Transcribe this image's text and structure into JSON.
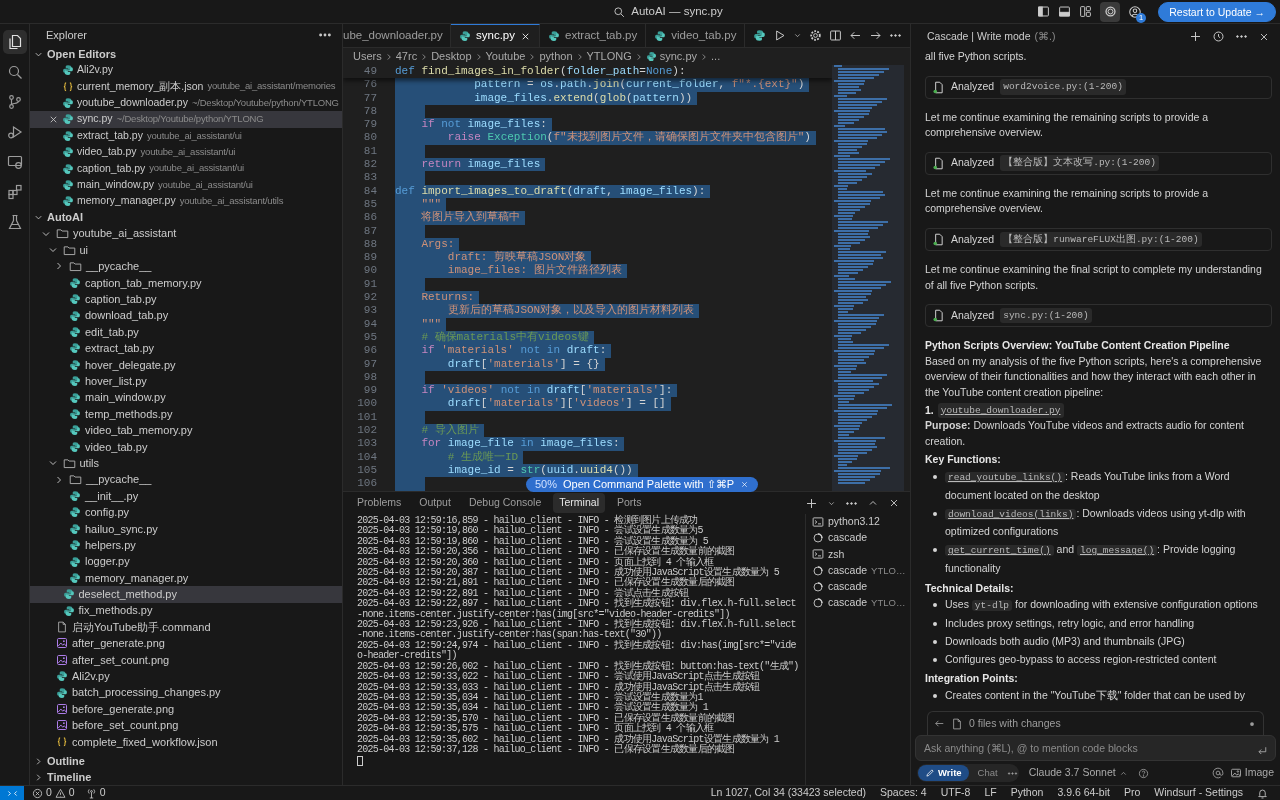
{
  "title_bar": {
    "title": "AutoAI — sync.py",
    "cascade_toggle_on": true,
    "account_badge": "1",
    "update_button": "Restart to Update →"
  },
  "activity_bar": [
    {
      "selected": true
    },
    {
      "selected": false
    },
    {
      "selected": false
    },
    {
      "selected": false
    },
    {
      "selected": false
    },
    {
      "selected": false
    },
    {
      "selected": false
    }
  ],
  "explorer": {
    "title": "Explorer",
    "open_editors": {
      "title": "Open Editors",
      "expanded": true,
      "items": [
        {
          "kind": "py",
          "name": "Ali2v.py",
          "selected": false
        },
        {
          "kind": "json",
          "name": "current_memory_副本.json",
          "path": "youtube_ai_assistant/memories",
          "selected": false
        },
        {
          "kind": "py",
          "name": "youtube_downloader.py",
          "path": "~/Desktop/Youtube/python/YTLONG",
          "selected": false
        },
        {
          "kind": "py",
          "name": "sync.py",
          "path": "~/Desktop/Youtube/python/YTLONG",
          "selected": true
        },
        {
          "kind": "py",
          "name": "extract_tab.py",
          "path": "youtube_ai_assistant/ui",
          "selected": false
        },
        {
          "kind": "py",
          "name": "video_tab.py",
          "path": "youtube_ai_assistant/ui",
          "selected": false
        },
        {
          "kind": "py",
          "name": "caption_tab.py",
          "path": "youtube_ai_assistant/ui",
          "selected": false
        },
        {
          "kind": "py",
          "name": "main_window.py",
          "path": "youtube_ai_assistant/ui",
          "selected": false
        },
        {
          "kind": "py",
          "name": "memory_manager.py",
          "path": "youtube_ai_assistant/utils",
          "selected": false
        }
      ]
    },
    "folder": {
      "title": "AutoAI",
      "expanded": true,
      "children": [
        {
          "kind": "folder",
          "name": "youtube_ai_assistant",
          "expanded": true,
          "selected": false,
          "children": [
            {
              "kind": "folder",
              "name": "ui",
              "expanded": true,
              "selected": false,
              "children": [
                {
                  "kind": "folder",
                  "name": "__pycache__",
                  "expanded": false,
                  "selected": false
                },
                {
                  "kind": "py",
                  "name": "caption_tab_memory.py",
                  "selected": false
                },
                {
                  "kind": "py",
                  "name": "caption_tab.py",
                  "selected": false
                },
                {
                  "kind": "py",
                  "name": "download_tab.py",
                  "selected": false
                },
                {
                  "kind": "py",
                  "name": "edit_tab.py",
                  "selected": false
                },
                {
                  "kind": "py",
                  "name": "extract_tab.py",
                  "selected": false
                },
                {
                  "kind": "py",
                  "name": "hover_delegate.py",
                  "selected": false
                },
                {
                  "kind": "py",
                  "name": "hover_list.py",
                  "selected": false
                },
                {
                  "kind": "py",
                  "name": "main_window.py",
                  "selected": false
                },
                {
                  "kind": "py",
                  "name": "temp_methods.py",
                  "selected": false
                },
                {
                  "kind": "py",
                  "name": "video_tab_memory.py",
                  "selected": false
                },
                {
                  "kind": "py",
                  "name": "video_tab.py",
                  "selected": false
                }
              ]
            },
            {
              "kind": "folder",
              "name": "utils",
              "expanded": true,
              "selected": false,
              "children": [
                {
                  "kind": "folder",
                  "name": "__pycache__",
                  "expanded": false,
                  "selected": false
                },
                {
                  "kind": "py",
                  "name": "__init__.py",
                  "selected": false
                },
                {
                  "kind": "py",
                  "name": "config.py",
                  "selected": false
                },
                {
                  "kind": "py",
                  "name": "hailuo_sync.py",
                  "selected": false
                },
                {
                  "kind": "py",
                  "name": "helpers.py",
                  "selected": false
                },
                {
                  "kind": "py",
                  "name": "logger.py",
                  "selected": false
                },
                {
                  "kind": "py",
                  "name": "memory_manager.py",
                  "selected": false
                }
              ]
            },
            {
              "kind": "py",
              "name": "deselect_method.py",
              "selected": true
            },
            {
              "kind": "py",
              "name": "fix_methods.py",
              "selected": false
            }
          ]
        },
        {
          "kind": "file",
          "name": "启动YouTube助手.command",
          "selected": false
        },
        {
          "kind": "png",
          "name": "after_generate.png",
          "selected": false
        },
        {
          "kind": "png",
          "name": "after_set_count.png",
          "selected": false
        },
        {
          "kind": "py",
          "name": "Ali2v.py",
          "selected": false
        },
        {
          "kind": "py",
          "name": "batch_processing_changes.py",
          "selected": false
        },
        {
          "kind": "png",
          "name": "before_generate.png",
          "selected": false
        },
        {
          "kind": "png",
          "name": "before_set_count.png",
          "selected": false
        },
        {
          "kind": "json",
          "name": "complete_fixed_workflow.json",
          "selected": false
        }
      ]
    },
    "outline": {
      "title": "Outline",
      "expanded": false
    },
    "timeline": {
      "title": "Timeline",
      "expanded": false
    }
  },
  "editor_tabs": [
    {
      "label": "ube_downloader.py",
      "icon": false,
      "selected": false
    },
    {
      "label": "sync.py",
      "icon": true,
      "selected": true
    },
    {
      "label": "extract_tab.py",
      "icon": true,
      "selected": false
    },
    {
      "label": "video_tab.py",
      "icon": true,
      "selected": false
    }
  ],
  "breadcrumbs": [
    {
      "kind": "folder",
      "label": "Users"
    },
    {
      "kind": "folder",
      "label": "47rc"
    },
    {
      "kind": "folder",
      "label": "Desktop"
    },
    {
      "kind": "folder",
      "label": "Youtube"
    },
    {
      "kind": "folder",
      "label": "python"
    },
    {
      "kind": "folder",
      "label": "YTLONG"
    },
    {
      "kind": "file",
      "label": "sync.py"
    },
    {
      "kind": "more",
      "label": "..."
    }
  ],
  "sticky_line": {
    "n": "49",
    "tokens": [
      {
        "kind": "keyword",
        "text": "def"
      },
      {
        "kind": "function",
        "text": " find_images_in_folder"
      },
      {
        "kind": "plain",
        "text": "("
      },
      {
        "kind": "variable",
        "text": "folder_path"
      },
      {
        "kind": "plain",
        "text": "="
      },
      {
        "kind": "keyword",
        "text": "None"
      },
      {
        "kind": "plain",
        "text": "):"
      }
    ]
  },
  "code": {
    "selected": true,
    "lines": [
      {
        "n": "76",
        "tokens": [
          {
            "kind": "variable",
            "text": "            pattern"
          },
          {
            "kind": "plain",
            "text": " = "
          },
          {
            "kind": "variable",
            "text": "os"
          },
          {
            "kind": "plain",
            "text": "."
          },
          {
            "kind": "variable",
            "text": "path"
          },
          {
            "kind": "plain",
            "text": "."
          },
          {
            "kind": "function",
            "text": "join"
          },
          {
            "kind": "plain",
            "text": "("
          },
          {
            "kind": "variable",
            "text": "current_folder"
          },
          {
            "kind": "plain",
            "text": ","
          },
          {
            "kind": "string",
            "text": " f\"*.{ext}\""
          },
          {
            "kind": "plain",
            "text": ")"
          }
        ]
      },
      {
        "n": "77",
        "tokens": [
          {
            "kind": "variable",
            "text": "            image_files"
          },
          {
            "kind": "plain",
            "text": "."
          },
          {
            "kind": "function",
            "text": "extend"
          },
          {
            "kind": "plain",
            "text": "("
          },
          {
            "kind": "function",
            "text": "glob"
          },
          {
            "kind": "plain",
            "text": "("
          },
          {
            "kind": "variable",
            "text": "pattern"
          },
          {
            "kind": "plain",
            "text": "))"
          }
        ]
      },
      {
        "n": "78"
      },
      {
        "n": "79",
        "tokens": [
          {
            "kind": "control",
            "text": "    if"
          },
          {
            "kind": "keyword",
            "text": " not"
          },
          {
            "kind": "variable",
            "text": " image_files"
          },
          {
            "kind": "plain",
            "text": ":"
          }
        ]
      },
      {
        "n": "80",
        "tokens": [
          {
            "kind": "control",
            "text": "        raise"
          },
          {
            "kind": "builtin",
            "text": " Exception"
          },
          {
            "kind": "plain",
            "text": "("
          },
          {
            "kind": "string",
            "text": "f\"未找到图片文件，请确保图片文件夹中包含图片\""
          },
          {
            "kind": "plain",
            "text": ")"
          }
        ]
      },
      {
        "n": "81"
      },
      {
        "n": "82",
        "tokens": [
          {
            "kind": "control",
            "text": "    return"
          },
          {
            "kind": "variable",
            "text": " image_files"
          }
        ]
      },
      {
        "n": "83"
      },
      {
        "n": "84",
        "tokens": [
          {
            "kind": "keyword",
            "text": "def"
          },
          {
            "kind": "function",
            "text": " import_images_to_draft"
          },
          {
            "kind": "plain",
            "text": "("
          },
          {
            "kind": "variable",
            "text": "draft"
          },
          {
            "kind": "plain",
            "text": ","
          },
          {
            "kind": "variable",
            "text": " image_files"
          },
          {
            "kind": "plain",
            "text": "):"
          }
        ]
      },
      {
        "n": "85",
        "tokens": [
          {
            "kind": "string",
            "text": "    \"\"\""
          }
        ]
      },
      {
        "n": "86",
        "tokens": [
          {
            "kind": "string",
            "text": "    将图片导入到草稿中"
          }
        ]
      },
      {
        "n": "87"
      },
      {
        "n": "88",
        "tokens": [
          {
            "kind": "string",
            "text": "    Args:"
          }
        ]
      },
      {
        "n": "89",
        "tokens": [
          {
            "kind": "string",
            "text": "        draft: 剪映草稿JSON对象"
          }
        ]
      },
      {
        "n": "90",
        "tokens": [
          {
            "kind": "string",
            "text": "        image_files: 图片文件路径列表"
          }
        ]
      },
      {
        "n": "91"
      },
      {
        "n": "92",
        "tokens": [
          {
            "kind": "string",
            "text": "    Returns:"
          }
        ]
      },
      {
        "n": "93",
        "tokens": [
          {
            "kind": "string",
            "text": "        更新后的草稿JSON对象，以及导入的图片材料列表"
          }
        ]
      },
      {
        "n": "94",
        "tokens": [
          {
            "kind": "string",
            "text": "    \"\"\""
          }
        ]
      },
      {
        "n": "95",
        "tokens": [
          {
            "kind": "comment",
            "text": "    # 确保materials中有videos键"
          }
        ]
      },
      {
        "n": "96",
        "tokens": [
          {
            "kind": "control",
            "text": "    if"
          },
          {
            "kind": "string",
            "text": " 'materials'"
          },
          {
            "kind": "keyword",
            "text": " not in"
          },
          {
            "kind": "variable",
            "text": " draft"
          },
          {
            "kind": "plain",
            "text": ":"
          }
        ]
      },
      {
        "n": "97",
        "tokens": [
          {
            "kind": "variable",
            "text": "        draft"
          },
          {
            "kind": "plain",
            "text": "["
          },
          {
            "kind": "string",
            "text": "'materials'"
          },
          {
            "kind": "plain",
            "text": "] = {}"
          }
        ]
      },
      {
        "n": "98"
      },
      {
        "n": "99",
        "tokens": [
          {
            "kind": "control",
            "text": "    if"
          },
          {
            "kind": "string",
            "text": " 'videos'"
          },
          {
            "kind": "keyword",
            "text": " not in"
          },
          {
            "kind": "variable",
            "text": " draft"
          },
          {
            "kind": "plain",
            "text": "["
          },
          {
            "kind": "string",
            "text": "'materials'"
          },
          {
            "kind": "plain",
            "text": "]:"
          }
        ]
      },
      {
        "n": "100",
        "tokens": [
          {
            "kind": "variable",
            "text": "        draft"
          },
          {
            "kind": "plain",
            "text": "["
          },
          {
            "kind": "string",
            "text": "'materials'"
          },
          {
            "kind": "plain",
            "text": "]["
          },
          {
            "kind": "string",
            "text": "'videos'"
          },
          {
            "kind": "plain",
            "text": "] = []"
          }
        ]
      },
      {
        "n": "101"
      },
      {
        "n": "102",
        "tokens": [
          {
            "kind": "comment",
            "text": "    # 导入图片"
          }
        ]
      },
      {
        "n": "103",
        "tokens": [
          {
            "kind": "control",
            "text": "    for"
          },
          {
            "kind": "variable",
            "text": " image_file"
          },
          {
            "kind": "keyword",
            "text": " in"
          },
          {
            "kind": "variable",
            "text": " image_files"
          },
          {
            "kind": "plain",
            "text": ":"
          }
        ]
      },
      {
        "n": "104",
        "tokens": [
          {
            "kind": "comment",
            "text": "        # 生成唯一ID"
          }
        ]
      },
      {
        "n": "105",
        "tokens": [
          {
            "kind": "variable",
            "text": "        image_id"
          },
          {
            "kind": "plain",
            "text": " = "
          },
          {
            "kind": "builtin",
            "text": "str"
          },
          {
            "kind": "plain",
            "text": "("
          },
          {
            "kind": "variable",
            "text": "uuid"
          },
          {
            "kind": "plain",
            "text": "."
          },
          {
            "kind": "function",
            "text": "uuid4"
          },
          {
            "kind": "plain",
            "text": "())"
          }
        ]
      },
      {
        "n": "106"
      }
    ]
  },
  "toast": {
    "percent": "50%",
    "text": "Open Command Palette with ⇧⌘P"
  },
  "panel_tabs": [
    {
      "label": "Problems",
      "selected": false
    },
    {
      "label": "Output",
      "selected": false
    },
    {
      "label": "Debug Console",
      "selected": false
    },
    {
      "label": "Terminal",
      "selected": true
    },
    {
      "label": "Ports",
      "selected": false
    }
  ],
  "terminal_lines": [
    "2025-04-03 12:59:16,859 - hailuo_client - INFO - 检测到图片上传成功",
    "2025-04-03 12:59:19,860 - hailuo_client - INFO - 尝试设置生成数量为5",
    "2025-04-03 12:59:19,860 - hailuo_client - INFO - 尝试设置生成数量为 5",
    "2025-04-03 12:59:20,356 - hailuo_client - INFO - 已保存设置生成数量前的截图",
    "2025-04-03 12:59:20,360 - hailuo_client - INFO - 页面上找到 4 个输入框",
    "2025-04-03 12:59:20,387 - hailuo_client - INFO - 成功使用JavaScript设置生成数量为 5",
    "2025-04-03 12:59:21,891 - hailuo_client - INFO - 已保存设置生成数量后的截图",
    "2025-04-03 12:59:22,891 - hailuo_client - INFO - 尝试点击生成按钮",
    "2025-04-03 12:59:22,897 - hailuo_client - INFO - 找到生成按钮: div.flex.h-full.select-none.items-center.justify-center:has(img[src*=\"video-header-credits\"])",
    "2025-04-03 12:59:23,926 - hailuo_client - INFO - 找到生成按钮: div.flex.h-full.select-none.items-center.justify-center:has(span:has-text(\"30\"))",
    "2025-04-03 12:59:24,974 - hailuo_client - INFO - 找到生成按钮: div:has(img[src*=\"video-header-credits\"])",
    "2025-04-03 12:59:26,002 - hailuo_client - INFO - 找到生成按钮: button:has-text(\"生成\")",
    "2025-04-03 12:59:33,022 - hailuo_client - INFO - 尝试使用JavaScript点击生成按钮",
    "2025-04-03 12:59:33,033 - hailuo_client - INFO - 成功使用JavaScript点击生成按钮",
    "2025-04-03 12:59:35,034 - hailuo_client - INFO - 尝试设置生成数量为1",
    "2025-04-03 12:59:35,034 - hailuo_client - INFO - 尝试设置生成数量为 1",
    "2025-04-03 12:59:35,570 - hailuo_client - INFO - 已保存设置生成数量前的截图",
    "2025-04-03 12:59:35,575 - hailuo_client - INFO - 页面上找到 4 个输入框",
    "2025-04-03 12:59:35,602 - hailuo_client - INFO - 成功使用JavaScript设置生成数量为 1",
    "2025-04-03 12:59:37,128 - hailuo_client - INFO - 已保存设置生成数量后的截图"
  ],
  "terminal_sessions": [
    {
      "kind": "shell",
      "name": "python3.12"
    },
    {
      "kind": "cascade",
      "name": "cascade"
    },
    {
      "kind": "shell",
      "name": "zsh"
    },
    {
      "kind": "cascade",
      "name": "cascade",
      "detail": "YTLO…"
    },
    {
      "kind": "cascade",
      "name": "cascade"
    },
    {
      "kind": "cascade",
      "name": "cascade",
      "detail": "YTLO…"
    }
  ],
  "cascade": {
    "title": "Cascade | Write mode",
    "shortcut": "(⌘.)",
    "messages": [
      {
        "kind": "text",
        "text": "all five Python scripts."
      },
      {
        "kind": "tool",
        "label": "Analyzed",
        "file": "word2voice.py:(1-200)"
      },
      {
        "kind": "text",
        "text": "Let me continue examining the remaining scripts to provide a comprehensive overview."
      },
      {
        "kind": "tool",
        "label": "Analyzed",
        "file": "【整合版】文本改写.py:(1-200)"
      },
      {
        "kind": "text",
        "text": "Let me continue examining the remaining scripts to provide a comprehensive overview."
      },
      {
        "kind": "tool",
        "label": "Analyzed",
        "file": "【整合版】runwareFLUX出图.py:(1-200)"
      },
      {
        "kind": "text",
        "text": "Let me continue examining the final script to complete my understanding of all five Python scripts."
      },
      {
        "kind": "tool",
        "label": "Analyzed",
        "file": "sync.py:(1-200)"
      },
      {
        "kind": "heading",
        "text": "Python Scripts Overview: YouTube Content Creation Pipeline"
      },
      {
        "kind": "text",
        "text": "Based on my analysis of the five Python scripts, here's a comprehensive overview of their functionalities and how they interact with each other in the YouTube content creation pipeline:"
      },
      {
        "kind": "numbered",
        "number": "1.",
        "code": "youtube_downloader.py"
      },
      {
        "kind": "rich",
        "text": "**Purpose:** Downloads YouTube videos and extracts audio for content creation."
      },
      {
        "kind": "heading",
        "text": "Key Functions:"
      },
      {
        "kind": "bullet",
        "parts": [
          {
            "kind": "link",
            "text": "read_youtube_links()"
          },
          {
            "kind": "text",
            "text": ": Reads YouTube links from a Word document located on the desktop"
          }
        ]
      },
      {
        "kind": "bullet",
        "parts": [
          {
            "kind": "link",
            "text": "download_videos(links)"
          },
          {
            "kind": "text",
            "text": ": Downloads videos using yt-dlp with optimized configurations"
          }
        ]
      },
      {
        "kind": "bullet",
        "parts": [
          {
            "kind": "link",
            "text": "get_current_time()"
          },
          {
            "kind": "text",
            "text": " and "
          },
          {
            "kind": "link",
            "text": "log_message()"
          },
          {
            "kind": "text",
            "text": ": Provide logging functionality"
          }
        ]
      },
      {
        "kind": "heading",
        "text": "Technical Details:"
      },
      {
        "kind": "bullet",
        "parts": [
          {
            "kind": "text",
            "text": "Uses "
          },
          {
            "kind": "code",
            "text": "yt-dlp"
          },
          {
            "kind": "text",
            "text": " for downloading with extensive configuration options"
          }
        ]
      },
      {
        "kind": "bullet",
        "parts": [
          {
            "kind": "text",
            "text": "Includes proxy settings, retry logic, and error handling"
          }
        ]
      },
      {
        "kind": "bullet",
        "parts": [
          {
            "kind": "text",
            "text": "Downloads both audio (MP3) and thumbnails (JPG)"
          }
        ]
      },
      {
        "kind": "bullet",
        "parts": [
          {
            "kind": "text",
            "text": "Configures geo-bypass to access region-restricted content"
          }
        ]
      },
      {
        "kind": "heading",
        "text": "Integration Points:"
      },
      {
        "kind": "bullet",
        "parts": [
          {
            "kind": "text",
            "text": "Creates content in the \"YouTube下载\" folder that can be used by"
          }
        ]
      }
    ],
    "changes": "0 files with changes",
    "input": {
      "placeholder": "Ask anything (⌘L), @ to mention code blocks"
    },
    "modes": [
      {
        "label": "Write",
        "selected": true
      },
      {
        "label": "Chat",
        "selected": false
      }
    ],
    "model": "Claude 3.7 Sonnet",
    "image_button": "Image"
  },
  "status_bar": {
    "errors": "0",
    "warnings": "0",
    "ports": "0",
    "items": [
      "Ln 1027, Col 34 (33423 selected)",
      "Spaces: 4",
      "UTF-8",
      "LF",
      "Python",
      "3.9.6 64-bit",
      "Pro",
      "Windsurf - Settings"
    ]
  }
}
